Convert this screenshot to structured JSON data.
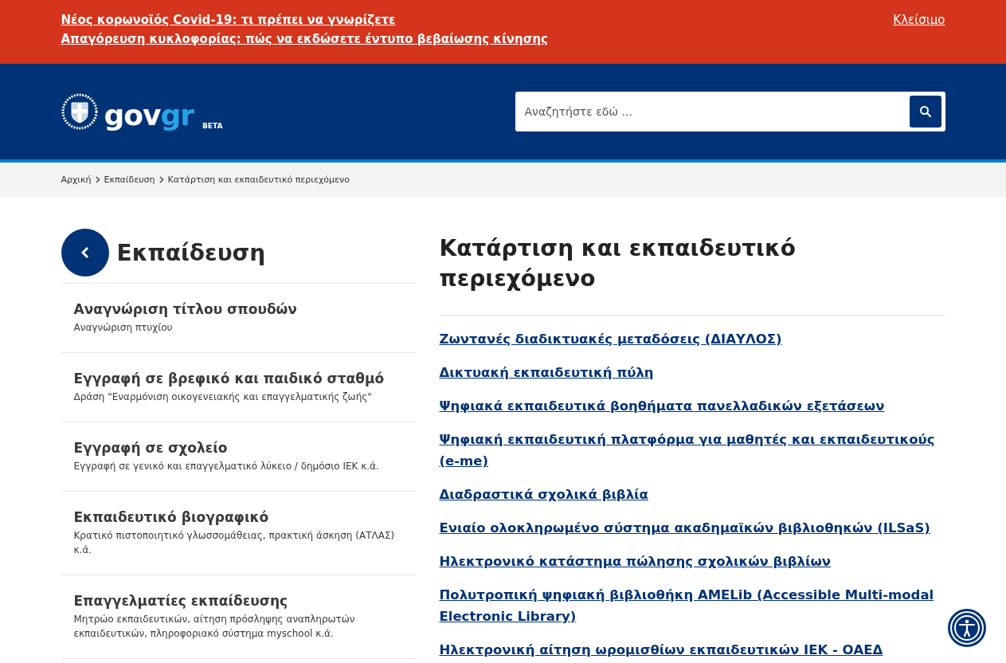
{
  "alert_banner": {
    "links": [
      "Νέος κορωνοϊός Covid-19: τι πρέπει να γνωρίζετε",
      "Απαγόρευση κυκλοφορίας: πώς να εκδώσετε έντυπο βεβαίωσης κίνησης"
    ],
    "close": "Κλείσιμο"
  },
  "header": {
    "logo": {
      "part_1": "gov",
      "part_2": "gr",
      "badge": "BETA"
    },
    "search": {
      "placeholder": "Αναζητήστε εδώ ..."
    }
  },
  "breadcrumb": [
    "Αρχική",
    "Εκπαίδευση",
    "Κατάρτιση και εκπαιδευτικό περιεχόμενο"
  ],
  "sidebar": {
    "title": "Εκπαίδευση",
    "items": [
      {
        "title": "Αναγνώριση τίτλου σπουδών",
        "description": "Αναγνώριση πτυχίου"
      },
      {
        "title": "Εγγραφή σε βρεφικό και παιδικό σταθμό",
        "description": "Δράση \"Εναρμόνιση οικογενειακής και επαγγελματικής ζωής\""
      },
      {
        "title": "Εγγραφή σε σχολείο",
        "description": "Εγγραφή σε γενικό και επαγγελματικό λύκειο / δημόσιο ΙΕΚ κ.ά."
      },
      {
        "title": "Εκπαιδευτικό βιογραφικό",
        "description": "Κρατικό πιστοποιητικό γλωσσομάθειας, πρακτική άσκηση (ΑΤΛΑΣ) κ.ά."
      },
      {
        "title": "Επαγγελματίες εκπαίδευσης",
        "description": "Μητρώο εκπαιδευτικών, αίτηση πρόσληψης αναπληρωτών εκπαιδευτικών, πληροφοριακό σύστημα myschool κ.ά."
      }
    ]
  },
  "main": {
    "title": "Κατάρτιση και εκπαιδευτικό περιεχόμενο",
    "links": [
      "Ζωντανές διαδικτυακές μεταδόσεις (ΔΙΑΥΛΟΣ)",
      "Δικτυακή εκπαιδευτική πύλη",
      "Ψηφιακά εκπαιδευτικά βοηθήματα πανελλαδικών εξετάσεων",
      "Ψηφιακή εκπαιδευτική πλατφόρμα για μαθητές και εκπαιδευτικούς (e-me)",
      "Διαδραστικά σχολικά βιβλία",
      "Ενιαίο ολοκληρωμένο σύστημα ακαδημαϊκών βιβλιοθηκών (ILSaS)",
      "Ηλεκτρονικό κατάστημα πώλησης σχολικών βιβλίων",
      "Πολυτροπική ψηφιακή βιβλιοθήκη AMELib (Accessible Multi-modal Electronic Library)",
      "Ηλεκτρονική αίτηση ωρομισθίων εκπαιδευτικών ΙΕΚ - ΟΑΕΔ"
    ]
  }
}
